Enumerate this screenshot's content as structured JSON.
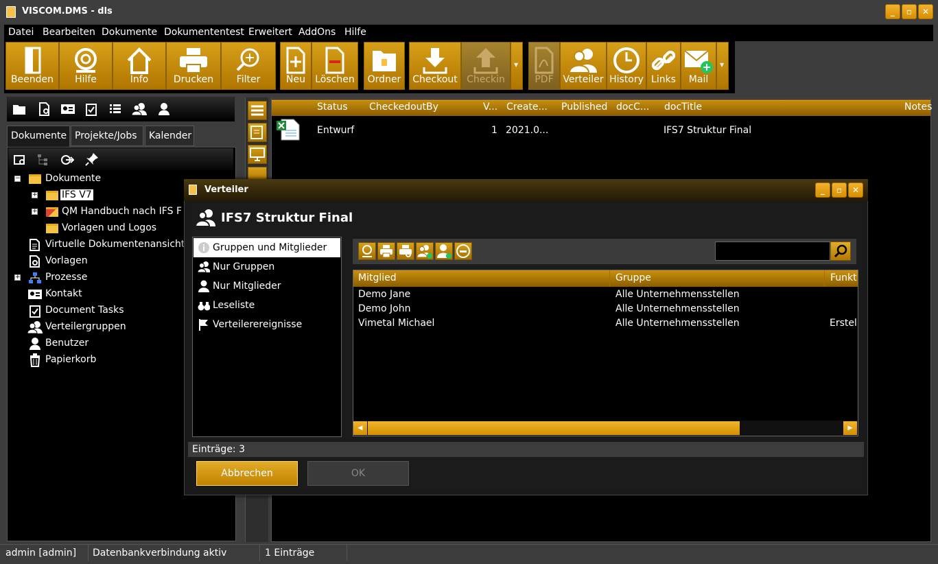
{
  "window": {
    "title": "VISCOM.DMS - dls",
    "minimize": "_",
    "maximize": "▫",
    "close": "✕"
  },
  "menu": [
    "Datei",
    "Bearbeiten",
    "Dokumente",
    "Dokumententest",
    "Erweitert",
    "AddOns",
    "Hilfe"
  ],
  "toolbar": {
    "beenden": "Beenden",
    "hilfe": "Hilfe",
    "info": "Info",
    "drucken": "Drucken",
    "filter": "Filter",
    "neu": "Neu",
    "loeschen": "Löschen",
    "ordner": "Ordner",
    "checkout": "Checkout",
    "checkin": "Checkin",
    "pdf": "PDF",
    "verteiler": "Verteiler",
    "history": "History",
    "links": "Links",
    "mail": "Mail"
  },
  "left_tabs": [
    "Dokumente",
    "Projekte/Jobs",
    "Kalender"
  ],
  "tree": {
    "dokumente": "Dokumente",
    "ifs_v7": "IFS V7",
    "qm": "QM Handbuch nach IFS F",
    "vorlagen_logos": "Vorlagen und Logos",
    "virtuelle": "Virtuelle Dokumentenansicht",
    "vorlagen": "Vorlagen",
    "prozesse": "Prozesse",
    "kontakt": "Kontakt",
    "tasks": "Document Tasks",
    "verteilergruppen": "Verteilergruppen",
    "benutzer": "Benutzer",
    "papierkorb": "Papierkorb"
  },
  "grid": {
    "columns": [
      "Status",
      "CheckedoutBy",
      "V...",
      "Create...",
      "Published",
      "docC...",
      "docTitle",
      "Notes"
    ],
    "row": {
      "status": "Entwurf",
      "version": "1",
      "created": "2021.0...",
      "title": "IFS7 Struktur Final"
    }
  },
  "dialog": {
    "title": "Verteiler",
    "heading": "IFS7 Struktur Final",
    "nav": [
      "Gruppen und Mitglieder",
      "Nur Gruppen",
      "Nur Mitglieder",
      "Leseliste",
      "Verteilerereignisse"
    ],
    "search_value": "",
    "table_columns": [
      "Mitglied",
      "Gruppe",
      "Funkt"
    ],
    "rows": [
      {
        "mitglied": "Demo Jane",
        "gruppe": "Alle Unternehmensstellen",
        "funktion": ""
      },
      {
        "mitglied": "Demo John",
        "gruppe": "Alle Unternehmensstellen",
        "funktion": ""
      },
      {
        "mitglied": "Vimetal Michael",
        "gruppe": "Alle Unternehmensstellen",
        "funktion": "Erstel"
      }
    ],
    "count": "Einträge: 3",
    "cancel": "Abbrechen",
    "ok": "OK"
  },
  "status": {
    "user": "admin [admin]",
    "db": "Datenbankverbindung aktiv",
    "entries": "1 Einträge"
  },
  "colors": {
    "accent": "#d7a019",
    "background": "#3c3c3c",
    "panel": "#000000"
  }
}
